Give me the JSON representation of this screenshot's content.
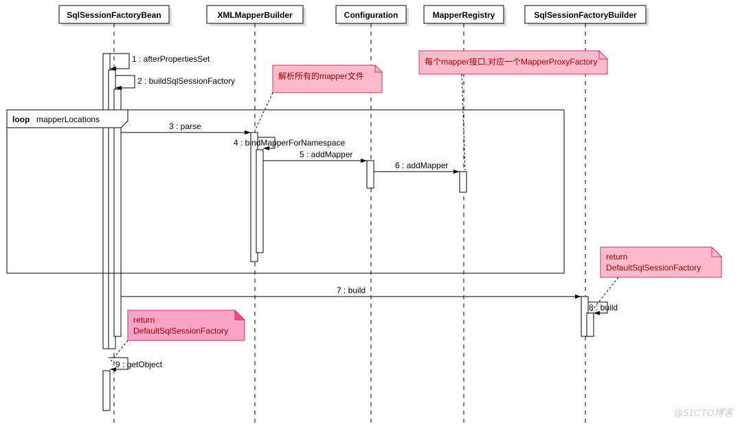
{
  "chart_data": {
    "type": "sequence_diagram",
    "participants": [
      "SqlSessionFactoryBean",
      "XMLMapperBuilder",
      "Configuration",
      "MapperRegistry",
      "SqlSessionFactoryBuilder"
    ],
    "messages": [
      {
        "n": 1,
        "from": "SqlSessionFactoryBean",
        "to": "SqlSessionFactoryBean",
        "label": "afterPropertiesSet"
      },
      {
        "n": 2,
        "from": "SqlSessionFactoryBean",
        "to": "SqlSessionFactoryBean",
        "label": "buildSqlSessionFactory"
      },
      {
        "n": 3,
        "from": "SqlSessionFactoryBean",
        "to": "XMLMapperBuilder",
        "label": "parse"
      },
      {
        "n": 4,
        "from": "XMLMapperBuilder",
        "to": "XMLMapperBuilder",
        "label": "bindMapperForNamespace"
      },
      {
        "n": 5,
        "from": "XMLMapperBuilder",
        "to": "Configuration",
        "label": "addMapper"
      },
      {
        "n": 6,
        "from": "Configuration",
        "to": "MapperRegistry",
        "label": "addMapper"
      },
      {
        "n": 7,
        "from": "SqlSessionFactoryBean",
        "to": "SqlSessionFactoryBuilder",
        "label": "build"
      },
      {
        "n": 8,
        "from": "SqlSessionFactoryBuilder",
        "to": "SqlSessionFactoryBuilder",
        "label": "build"
      },
      {
        "n": 9,
        "from": "SqlSessionFactoryBean",
        "to": "SqlSessionFactoryBean",
        "label": "getObject"
      }
    ],
    "fragments": [
      {
        "type": "loop",
        "label": "mapperLocations",
        "covers_messages": [
          3,
          4,
          5,
          6
        ]
      }
    ],
    "notes": [
      {
        "attached_to_message": 3,
        "text": "解析所有的mapper文件"
      },
      {
        "attached_to_message": 6,
        "text": "每个mapper接口,对应一个MapperProxyFactory"
      },
      {
        "attached_to_message": 7,
        "text": "return DefaultSqlSessionFactory"
      },
      {
        "attached_to_message": 8,
        "text": "return DefaultSqlSessionFactory"
      }
    ]
  },
  "participants": {
    "p1": "SqlSessionFactoryBean",
    "p2": "XMLMapperBuilder",
    "p3": "Configuration",
    "p4": "MapperRegistry",
    "p5": "SqlSessionFactoryBuilder"
  },
  "messages": {
    "m1": "1 : afterPropertiesSet",
    "m2": "2 : buildSqlSessionFactory",
    "m3": "3 : parse",
    "m4": "4 : bindMapperForNamespace",
    "m5": "5 : addMapper",
    "m6": "6 : addMapper",
    "m7": "7 : build",
    "m8": "8 : build",
    "m9": "9 : getObject"
  },
  "loop": {
    "keyword": "loop",
    "label": "mapperLocations"
  },
  "notes": {
    "n1": "解析所有的mapper文件",
    "n2": "每个mapper接口,对应一个MapperProxyFactory",
    "n3a": "return",
    "n3b": "DefaultSqlSessionFactory",
    "n4a": "return",
    "n4b": "DefaultSqlSessionFactory"
  },
  "watermark": "@51CTO博客"
}
